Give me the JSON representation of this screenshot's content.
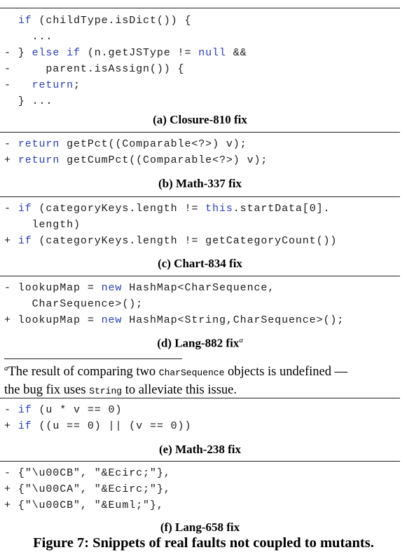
{
  "panels": [
    {
      "id": "a",
      "lines": [
        [
          {
            "t": "  "
          },
          {
            "t": "if",
            "k": 1
          },
          {
            "t": " (childType.isDict()) {"
          }
        ],
        [
          {
            "t": "    ..."
          }
        ],
        [
          {
            "t": "- } "
          },
          {
            "t": "else if",
            "k": 1
          },
          {
            "t": " (n.getJSType != "
          },
          {
            "t": "null",
            "k": 1
          },
          {
            "t": " &&"
          }
        ],
        [
          {
            "t": "-     parent.isAssign()) {"
          }
        ],
        [
          {
            "t": "-   "
          },
          {
            "t": "return",
            "k": 1
          },
          {
            "t": ";"
          }
        ],
        [
          {
            "t": "  } ..."
          }
        ]
      ],
      "caption": "(a) Closure-810 fix"
    },
    {
      "id": "b",
      "lines": [
        [
          {
            "t": "- "
          },
          {
            "t": "return",
            "k": 1
          },
          {
            "t": " getPct((Comparable<?>) v);"
          }
        ],
        [
          {
            "t": "+ "
          },
          {
            "t": "return",
            "k": 1
          },
          {
            "t": " getCumPct((Comparable<?>) v);"
          }
        ]
      ],
      "caption": "(b) Math-337 fix"
    },
    {
      "id": "c",
      "lines": [
        [
          {
            "t": "- "
          },
          {
            "t": "if",
            "k": 1
          },
          {
            "t": " (categoryKeys.length != "
          },
          {
            "t": "this",
            "k": 1
          },
          {
            "t": ".startData[0]."
          }
        ],
        [
          {
            "t": "    length)"
          }
        ],
        [
          {
            "t": "+ "
          },
          {
            "t": "if",
            "k": 1
          },
          {
            "t": " (categoryKeys.length != getCategoryCount())"
          }
        ]
      ],
      "caption": "(c) Chart-834 fix"
    },
    {
      "id": "d",
      "lines": [
        [
          {
            "t": "- lookupMap = "
          },
          {
            "t": "new",
            "k": 1
          },
          {
            "t": " HashMap<CharSequence,"
          }
        ],
        [
          {
            "t": "    CharSequence>();"
          }
        ],
        [
          {
            "t": "+ lookupMap = "
          },
          {
            "t": "new",
            "k": 1
          },
          {
            "t": " HashMap<String,CharSequence>();"
          }
        ]
      ],
      "caption": "(d) Lang-882 fix",
      "caption_sup": "a"
    },
    {
      "id": "e",
      "lines": [
        [
          {
            "t": "- "
          },
          {
            "t": "if",
            "k": 1
          },
          {
            "t": " (u * v == 0)"
          }
        ],
        [
          {
            "t": "+ "
          },
          {
            "t": "if",
            "k": 1
          },
          {
            "t": " ((u == 0) || (v == 0))"
          }
        ]
      ],
      "caption": "(e) Math-238 fix"
    },
    {
      "id": "f",
      "lines": [
        [
          {
            "t": "- {\"\\u00CB\", \"&Ecirc;\"},"
          }
        ],
        [
          {
            "t": "+ {\"\\u00CA\", \"&Ecirc;\"},"
          }
        ],
        [
          {
            "t": "+ {\"\\u00CB\", \"&Euml;\"},"
          }
        ]
      ],
      "caption": "(f) Lang-658 fix"
    }
  ],
  "footnote": {
    "marker": "a",
    "text_1": "The result of comparing two ",
    "code_1": "CharSequence",
    "text_2": " objects is undefined —",
    "text_3": "the bug fix uses ",
    "code_2": "String",
    "text_4": " to alleviate this issue."
  },
  "figure_caption": "Figure 7: Snippets of real faults not coupled to mutants.",
  "colors": {
    "keyword": "#2b3fb3",
    "text": "#1a1a1a"
  }
}
